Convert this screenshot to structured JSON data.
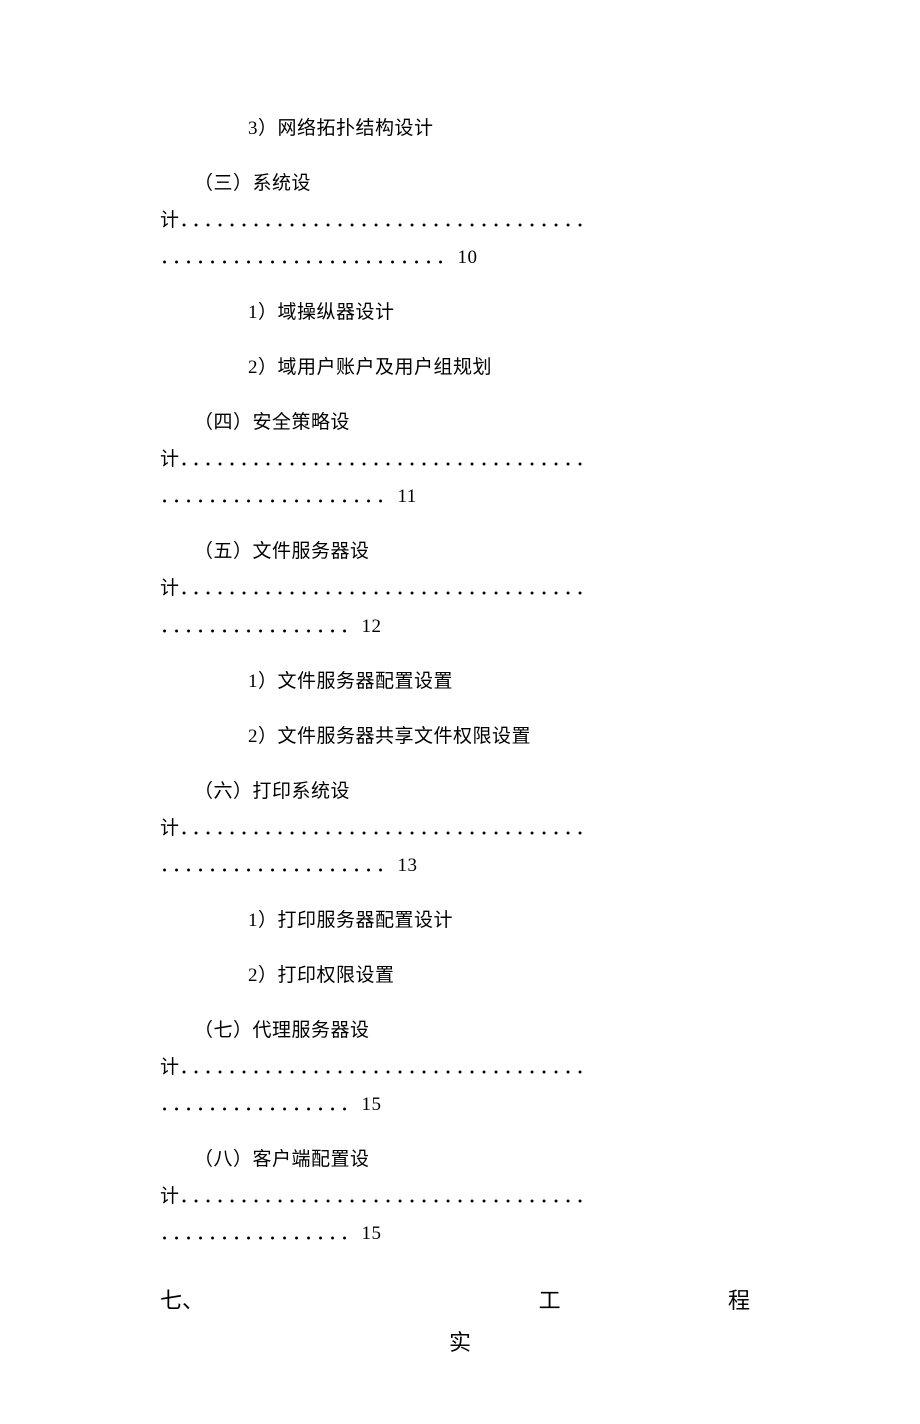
{
  "toc": {
    "item1_sub3": "3）网络拓扑结构设计",
    "sec3": {
      "label_part1": "（三）系统设",
      "label_part2": "计",
      "dots1": "．．．．．．．．．．．．．．．．．．．．．．．．．．．．．．．．．．",
      "dots2": "．．．．．．．．．．．．．．．．．．．．．．．．",
      "page": "10",
      "sub1": "1）域操纵器设计",
      "sub2": "2）域用户账户及用户组规划"
    },
    "sec4": {
      "label_part1": "（四）安全策略设",
      "label_part2": "计",
      "dots1": "．．．．．．．．．．．．．．．．．．．．．．．．．．．．．．．．．．",
      "dots2": "．．．．．．．．．．．．．．．．．．．",
      "page": "11"
    },
    "sec5": {
      "label_part1": "（五）文件服务器设",
      "label_part2": "计",
      "dots1": "．．．．．．．．．．．．．．．．．．．．．．．．．．．．．．．．．．",
      "dots2": "．．．．．．．．．．．．．．．．",
      "page": "12",
      "sub1": "1）文件服务器配置设置",
      "sub2": "2）文件服务器共享文件权限设置"
    },
    "sec6": {
      "label_part1": "（六）打印系统设",
      "label_part2": "计",
      "dots1": "．．．．．．．．．．．．．．．．．．．．．．．．．．．．．．．．．．",
      "dots2": "．．．．．．．．．．．．．．．．．．．",
      "page": "13",
      "sub1": "1）打印服务器配置设计",
      "sub2": "2）打印权限设置"
    },
    "sec7": {
      "label_part1": "（七）代理服务器设",
      "label_part2": "计",
      "dots1": "．．．．．．．．．．．．．．．．．．．．．．．．．．．．．．．．．．",
      "dots2": "．．．．．．．．．．．．．．．．",
      "page": "15"
    },
    "sec8": {
      "label_part1": "（八）客户端配置设",
      "label_part2": "计",
      "dots1": "．．．．．．．．．．．．．．．．．．．．．．．．．．．．．．．．．．",
      "dots2": "．．．．．．．．．．．．．．．．",
      "page": "15"
    }
  },
  "headline": {
    "left": "七、",
    "mid": "工",
    "right": "程",
    "row2": "实"
  }
}
